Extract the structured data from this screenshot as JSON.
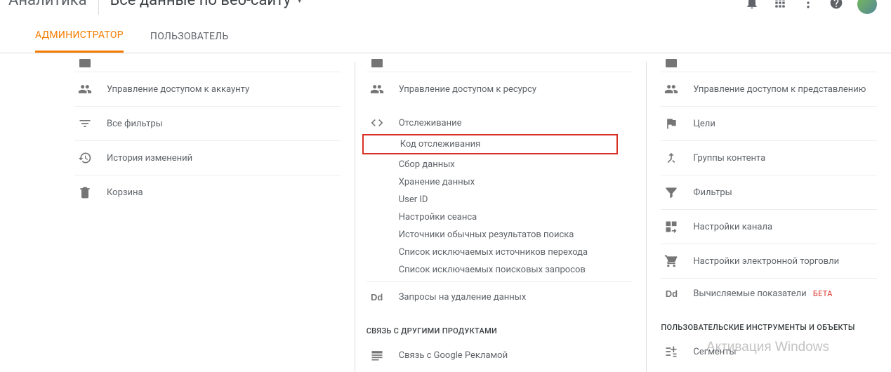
{
  "header": {
    "product_partial": "Аналитика",
    "view_name": "Все данные по веб-сайту"
  },
  "tabs": {
    "admin": "АДМИНИСТРАТОР",
    "user": "ПОЛЬЗОВАТЕЛЬ"
  },
  "account_col": {
    "access": "Управление доступом к аккаунту",
    "filters": "Все фильтры",
    "history": "История изменений",
    "trash": "Корзина"
  },
  "property_col": {
    "access": "Управление доступом к ресурсу",
    "tracking": "Отслеживание",
    "tracking_sub": {
      "code": "Код отслеживания",
      "data_collection": "Сбор данных",
      "data_retention": "Хранение данных",
      "user_id": "User ID",
      "session": "Настройки сеанса",
      "organic": "Источники обычных результатов поиска",
      "referral_exclusion": "Список исключаемых источников перехода",
      "search_term_exclusion": "Список исключаемых поисковых запросов"
    },
    "data_deletion": "Запросы на удаление данных",
    "section_links": "СВЯЗЬ С ДРУГИМИ ПРОДУКТАМИ",
    "adwords": "Связь с Google Рекламой"
  },
  "view_col": {
    "access": "Управление доступом к представлению",
    "goals": "Цели",
    "content_groups": "Группы контента",
    "filters": "Фильтры",
    "channel": "Настройки канала",
    "ecommerce": "Настройки электронной торговли",
    "calc_metrics": "Вычисляемые показатели",
    "beta": "БЕТА",
    "section_tools": "ПОЛЬЗОВАТЕЛЬСКИЕ ИНСТРУМЕНТЫ И ОБЪЕКТЫ",
    "segments": "Сегменты"
  },
  "watermark": "Активация Windows"
}
